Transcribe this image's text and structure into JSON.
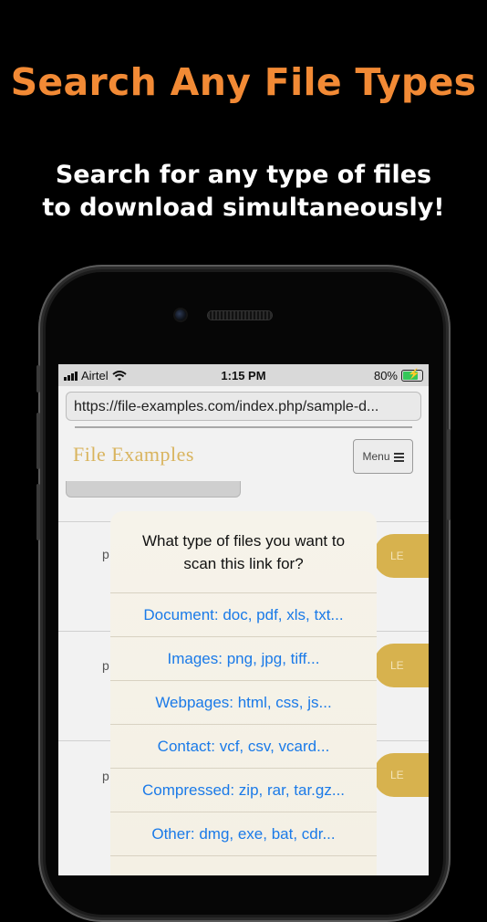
{
  "promo": {
    "headline": "Search Any File Types",
    "subline_1": "Search for any type of files",
    "subline_2": "to download simultaneously!"
  },
  "status_bar": {
    "carrier": "Airtel",
    "time": "1:15 PM",
    "battery": "80%",
    "battery_level": 0.8
  },
  "browser": {
    "url": "https://file-examples.com/index.php/sample-d..."
  },
  "site": {
    "title": "File Examples",
    "menu_label": "Menu"
  },
  "list": {
    "row_letter": "p",
    "download_label": "LE"
  },
  "dialog": {
    "title_1": "What type of files you want to",
    "title_2": "scan this link for?",
    "options": [
      "Document: doc, pdf, xls, txt...",
      "Images: png, jpg, tiff...",
      "Webpages: html, css, js...",
      "Contact: vcf, csv, vcard...",
      "Compressed: zip, rar, tar.gz...",
      "Other: dmg, exe, bat, cdr..."
    ]
  },
  "colors": {
    "headline": "#f28a35",
    "site_title": "#d9b45e",
    "option_link": "#1a7ae8",
    "download_button": "#d7b24e"
  }
}
